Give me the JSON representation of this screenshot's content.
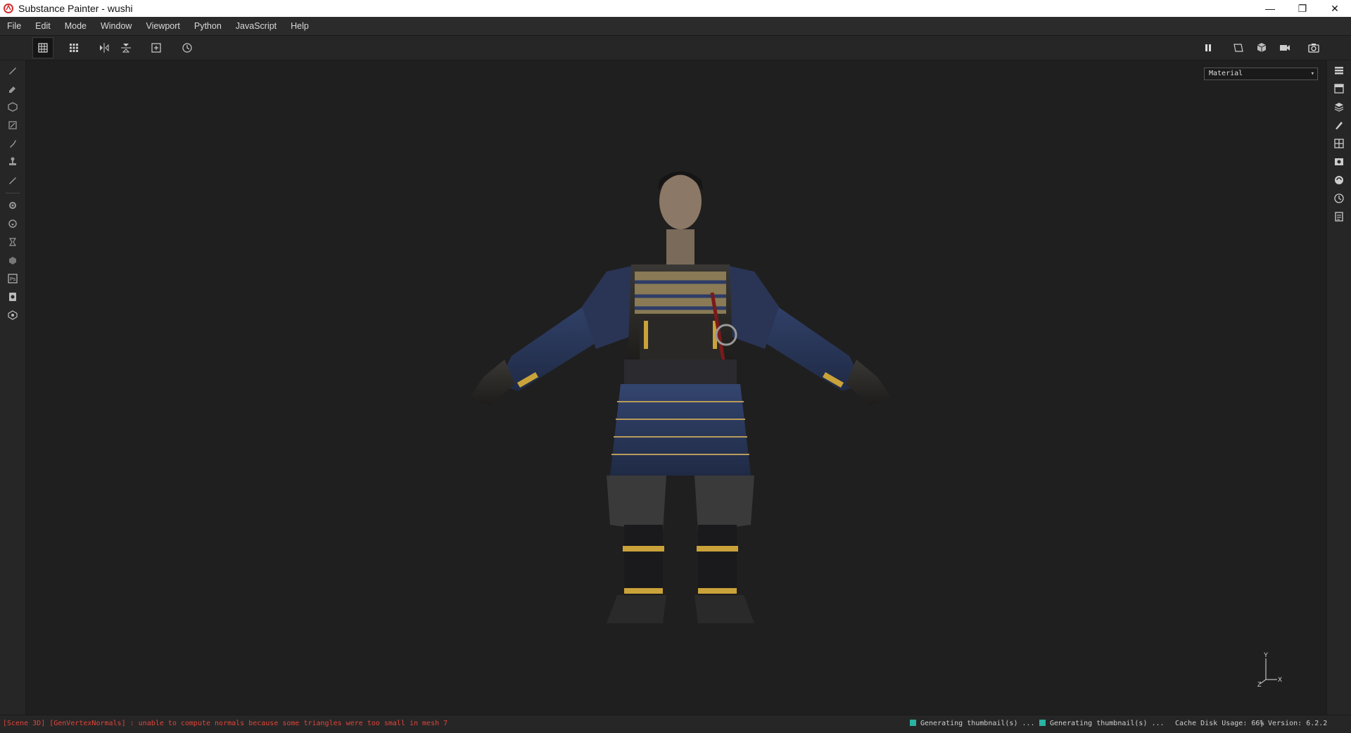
{
  "window": {
    "title": "Substance Painter - wushi",
    "controls": {
      "minimize": "—",
      "restore": "❐",
      "close": "✕"
    }
  },
  "menu": {
    "items": [
      "File",
      "Edit",
      "Mode",
      "Window",
      "Viewport",
      "Python",
      "JavaScript",
      "Help"
    ]
  },
  "toolbar": {
    "left_icons": [
      "grid-view-icon",
      "grid-menu-icon",
      "symmetry-x-icon",
      "symmetry-y-icon",
      "add-frame-icon",
      "history-icon"
    ],
    "right_icons": [
      "pause-icon",
      "display-mode-icon",
      "3d-view-icon",
      "camera-icon",
      "screenshot-icon"
    ]
  },
  "left_tools": {
    "icons": [
      "paint-brush-icon",
      "eraser-icon",
      "projection-icon",
      "polygon-fill-icon",
      "smudge-icon",
      "clone-stamp-icon",
      "color-picker-icon",
      "bake-settings-icon",
      "export-icon",
      "iray-icon",
      "effects-icon",
      "photoshop-icon",
      "document-icon",
      "plugin-icon"
    ]
  },
  "right_tools": {
    "icons": [
      "layers-list-icon",
      "texture-set-icon",
      "layer-stack-icon",
      "brush-settings-icon",
      "display-settings-icon",
      "camera-settings-icon",
      "shelf-icon",
      "history-panel-icon",
      "log-icon"
    ]
  },
  "viewport": {
    "channel_select": {
      "value": "Material"
    },
    "gizmo": {
      "y_label": "Y",
      "x_label": "X",
      "z_label": "Z"
    }
  },
  "status": {
    "error": "[Scene 3D] [GenVertexNormals] : unable to compute normals because some triangles were too small in mesh 7",
    "thumb1": "Generating thumbnail(s) ...",
    "thumb2": "Generating thumbnail(s) ...",
    "cache": "Cache Disk Usage:   66%",
    "version": "| Version: 6.2.2"
  },
  "colors": {
    "accent_teal": "#2bb3a3",
    "error_red": "#e0453a",
    "armor_blue": "#2d3c66",
    "gold": "#c9a23a"
  }
}
